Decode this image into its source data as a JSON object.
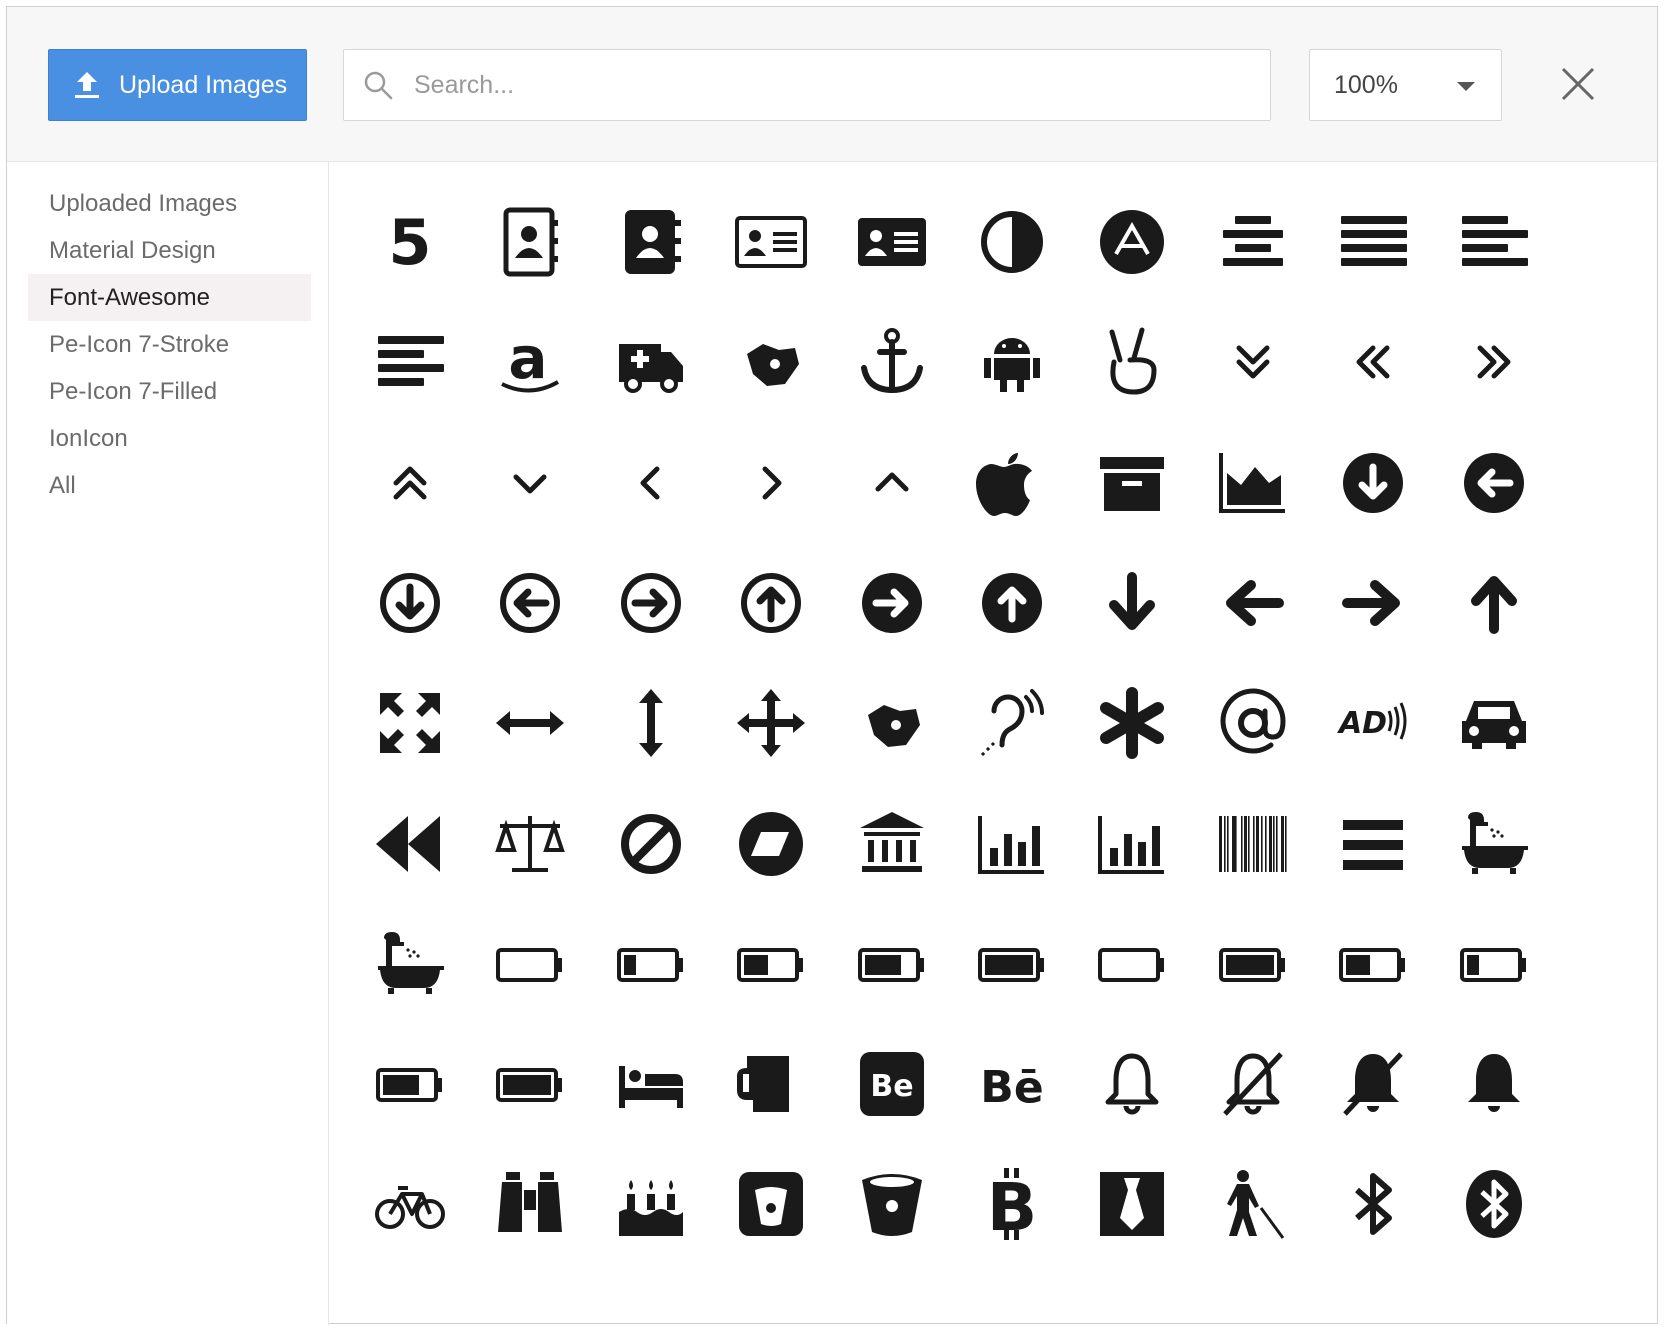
{
  "header": {
    "upload_label": "Upload Images",
    "search_placeholder": "Search...",
    "zoom_value": "100%"
  },
  "sidebar": {
    "items": [
      {
        "label": "Uploaded Images",
        "active": false
      },
      {
        "label": "Material Design",
        "active": false
      },
      {
        "label": "Font-Awesome",
        "active": true
      },
      {
        "label": "Pe-Icon 7-Stroke",
        "active": false
      },
      {
        "label": "Pe-Icon 7-Filled",
        "active": false
      },
      {
        "label": "IonIcon",
        "active": false
      },
      {
        "label": "All",
        "active": false
      }
    ]
  },
  "colors": {
    "accent": "#4a90e2",
    "icon": "#1a1a1a",
    "sidebar_active_bg": "#f5f0f2"
  },
  "icons": [
    "500px-icon",
    "address-book-icon",
    "address-book-solid-icon",
    "address-card-icon",
    "address-card-solid-icon",
    "adjust-icon",
    "adn-icon",
    "align-center-icon",
    "align-justify-icon",
    "align-left-icon",
    "align-right-icon",
    "amazon-icon",
    "ambulance-icon",
    "sign-language-icon",
    "anchor-icon",
    "android-icon",
    "angellist-icon",
    "angle-double-down-icon",
    "angle-double-left-icon",
    "angle-double-right-icon",
    "angle-double-up-icon",
    "angle-down-icon",
    "angle-left-icon",
    "angle-right-icon",
    "angle-up-icon",
    "apple-icon",
    "archive-icon",
    "area-chart-icon",
    "arrow-circle-down-icon",
    "arrow-circle-left-icon",
    "arrow-circle-o-down-icon",
    "arrow-circle-o-left-icon",
    "arrow-circle-o-right-icon",
    "arrow-circle-o-up-icon",
    "arrow-circle-right-icon",
    "arrow-circle-up-icon",
    "arrow-down-icon",
    "arrow-left-icon",
    "arrow-right-icon",
    "arrow-up-icon",
    "arrows-expand-icon",
    "arrows-h-icon",
    "arrows-v-icon",
    "arrows-icon",
    "asl-interpreting-icon",
    "assistive-listening-icon",
    "asterisk-icon",
    "at-icon",
    "audio-description-icon",
    "automobile-icon",
    "backward-icon",
    "balance-scale-icon",
    "ban-icon",
    "bandcamp-icon",
    "bank-icon",
    "bar-chart-icon",
    "bar-chart-o-icon",
    "barcode-icon",
    "bars-icon",
    "bath-icon",
    "bathtub-icon",
    "battery-empty-icon",
    "battery-quarter-icon",
    "battery-half-icon",
    "battery-three-quarters-icon",
    "battery-full-icon",
    "battery-0-icon",
    "battery-4-icon",
    "battery-2-icon",
    "battery-1-icon",
    "battery-3-icon",
    "battery-icon",
    "bed-icon",
    "beer-icon",
    "behance-square-icon",
    "behance-icon",
    "bell-o-icon",
    "bell-slash-o-icon",
    "bell-slash-icon",
    "bell-icon",
    "bicycle-icon",
    "binoculars-icon",
    "birthday-cake-icon",
    "bitbucket-square-icon",
    "bitbucket-icon",
    "bitcoin-icon",
    "black-tie-icon",
    "blind-icon",
    "bluetooth-b-icon",
    "bluetooth-icon"
  ]
}
